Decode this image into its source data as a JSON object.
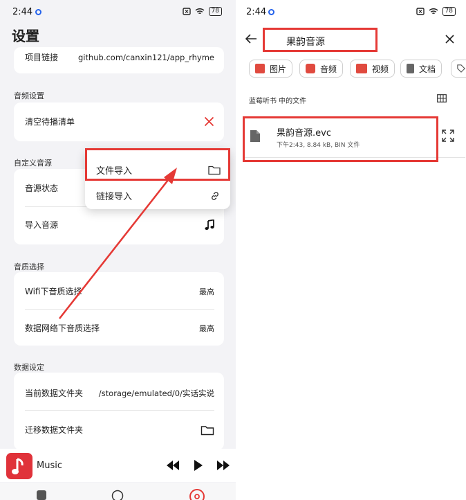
{
  "left": {
    "status": {
      "time": "2:44",
      "battery": "78"
    },
    "title": "设置",
    "project": {
      "label": "项目链接",
      "value": "github.com/canxin121/app_rhyme"
    },
    "audio_section": "音频设置",
    "clear_queue": "清空待播清单",
    "custom_source_section": "自定义音源",
    "source_status": "音源状态",
    "import_source": "导入音源",
    "popup": {
      "file_import": "文件导入",
      "link_import": "链接导入"
    },
    "quality_section": "音质选择",
    "wifi_quality": {
      "label": "Wifi下音质选择",
      "value": "最高"
    },
    "mobile_quality": {
      "label": "数据网络下音质选择",
      "value": "最高"
    },
    "data_section": "数据设定",
    "current_folder": {
      "label": "当前数据文件夹",
      "value": "/storage/emulated/0/实话实说"
    },
    "move_folder": "迁移数据文件夹",
    "player": {
      "title": "Music"
    }
  },
  "right": {
    "status": {
      "time": "2:44",
      "battery": "78"
    },
    "search_title": "果韵音源",
    "chips": [
      "图片",
      "音频",
      "视频",
      "文档"
    ],
    "location_label": "蓝莓听书 中的文件",
    "file": {
      "name": "果韵音源.evc",
      "meta": "下午2:43, 8.84 kB, BIN 文件"
    }
  },
  "colors": {
    "accent_red": "#e53935",
    "cover_red": "#e0323a"
  }
}
